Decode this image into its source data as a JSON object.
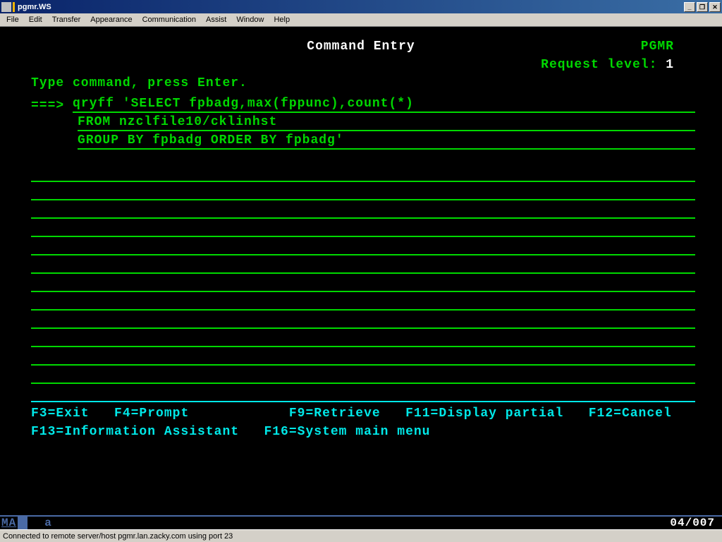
{
  "window": {
    "title": "pgmr.WS"
  },
  "menubar": {
    "items": [
      "File",
      "Edit",
      "Transfer",
      "Appearance",
      "Communication",
      "Assist",
      "Window",
      "Help"
    ]
  },
  "screen": {
    "title": "Command Entry",
    "user": "PGMR",
    "request_level_label": "Request level:",
    "request_level_value": "1",
    "instruction": "Type command, press Enter.",
    "prompt": "===> ",
    "command_lines": [
      "qryff 'SELECT fpbadg,max(fppunc),count(*)",
      "FROM nzclfile10/cklinhst",
      "GROUP BY fpbadg ORDER BY fpbadg'"
    ],
    "blank_line_count": 12
  },
  "fkeys": {
    "row1": {
      "f3": "F3=Exit",
      "f4": "F4=Prompt",
      "f9": "F9=Retrieve",
      "f11": "F11=Display partial",
      "f12": "F12=Cancel"
    },
    "row2": {
      "f13": "F13=Information Assistant",
      "f16": "F16=System main menu"
    }
  },
  "status": {
    "indicator": "MA",
    "mode": "a",
    "cursor_pos": "04/007"
  },
  "connection": {
    "text": "Connected to remote server/host pgmr.lan.zacky.com using port 23"
  }
}
